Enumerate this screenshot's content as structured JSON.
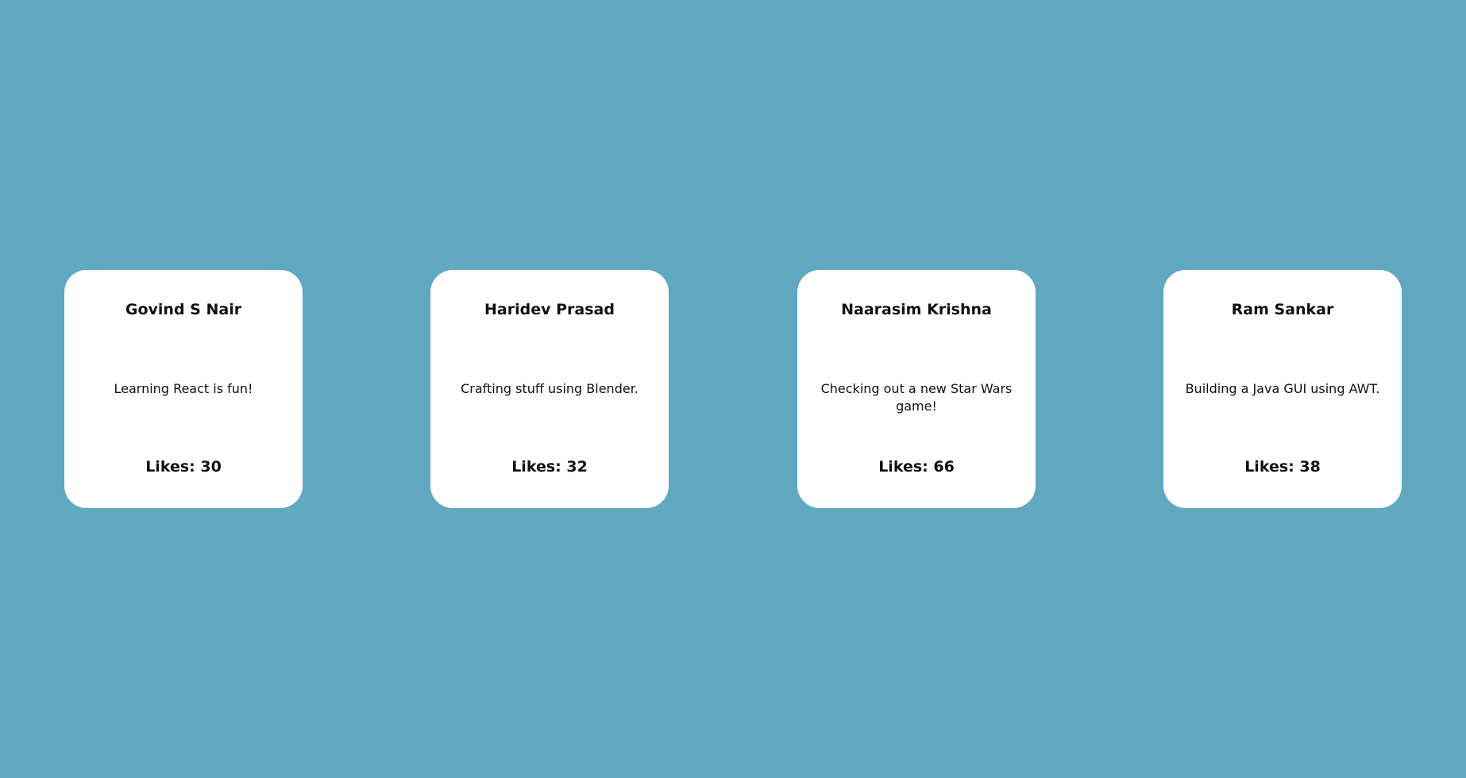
{
  "cards": [
    {
      "name": "Govind S Nair",
      "text": "Learning React is fun!",
      "likes": "Likes: 30"
    },
    {
      "name": "Haridev Prasad",
      "text": "Crafting stuff using Blender.",
      "likes": "Likes: 32"
    },
    {
      "name": "Naarasim Krishna",
      "text": "Checking out a new Star Wars game!",
      "likes": "Likes: 66"
    },
    {
      "name": "Ram Sankar",
      "text": "Building a Java GUI using AWT.",
      "likes": "Likes: 38"
    }
  ],
  "colors": {
    "background": "#61a8c1",
    "card": "#ffffff",
    "text": "#111111"
  }
}
